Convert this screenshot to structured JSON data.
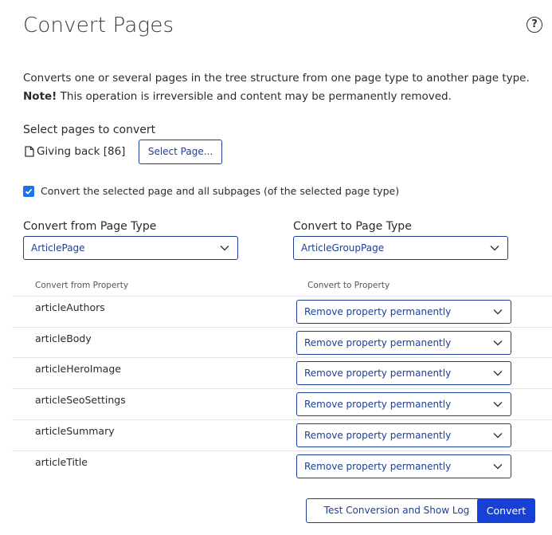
{
  "header": {
    "title": "Convert Pages",
    "help_icon": "question-circle-icon"
  },
  "description": {
    "line1": "Converts one or several pages in the tree structure from one page type to another page type.",
    "note_label": "Note!",
    "note_text": " This operation is irreversible and content may be permanently removed."
  },
  "select_pages": {
    "label": "Select pages to convert",
    "page_name": "Giving back [86]",
    "button_label": "Select Page..."
  },
  "subpages_checkbox": {
    "checked": true,
    "label": "Convert the selected page and all subpages (of the selected page type)"
  },
  "convert_from": {
    "label": "Convert from Page Type",
    "value": "ArticlePage"
  },
  "convert_to": {
    "label": "Convert to Page Type",
    "value": "ArticleGroupPage"
  },
  "properties": {
    "from_header": "Convert from Property",
    "to_header": "Convert to Property",
    "rows": [
      {
        "name": "articleAuthors",
        "target": "Remove property permanently"
      },
      {
        "name": "articleBody",
        "target": "Remove property permanently"
      },
      {
        "name": "articleHeroImage",
        "target": "Remove property permanently"
      },
      {
        "name": "articleSeoSettings",
        "target": "Remove property permanently"
      },
      {
        "name": "articleSummary",
        "target": "Remove property permanently"
      },
      {
        "name": "articleTitle",
        "target": "Remove property permanently"
      }
    ]
  },
  "actions": {
    "test_label": "Test Conversion and Show Log",
    "convert_label": "Convert"
  },
  "colors": {
    "accent": "#1d3f96",
    "primary_button": "#1640d6",
    "checkbox": "#1a73e8"
  }
}
